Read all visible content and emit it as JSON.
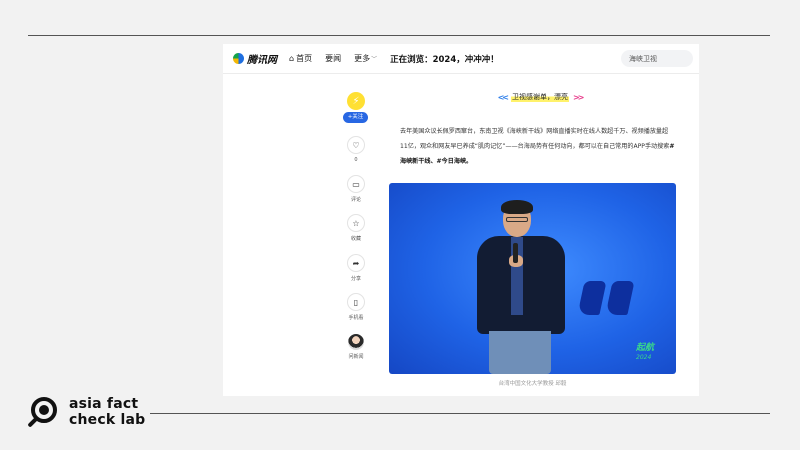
{
  "nav": {
    "logo_text": "腾讯网",
    "items": [
      "首页",
      "要闻",
      "更多"
    ],
    "headline": "正在浏览：2024，冲冲冲！",
    "search_value": "海峡卫视"
  },
  "sidebar": {
    "follow_label": "+关注",
    "actions": [
      {
        "label": "0",
        "icon": "heart-icon"
      },
      {
        "label": "评论",
        "icon": "comment-icon"
      },
      {
        "label": "收藏",
        "icon": "star-icon"
      },
      {
        "label": "分享",
        "icon": "share-icon"
      },
      {
        "label": "手机看",
        "icon": "phone-icon"
      },
      {
        "label": "问新闻",
        "icon": "avatar"
      }
    ]
  },
  "article": {
    "deco_title": "卫视感谢单，漂亮",
    "paragraph_plain": "去年美国众议长佩罗西窜台，东南卫视《海峡新干线》网络直播实时在线人数超千万、视频播放量超11亿，观众和网友早已养成“肌肉记忆”——台海局势有任何动向，都可以在自己常用的APP手动搜索",
    "paragraph_bold": "#海峡新干线、#今日海峡。",
    "photo_logo_1": "起航",
    "photo_logo_2": "2024",
    "caption": "台湾中国文化大学教授 邱毅"
  },
  "brand": {
    "line1": "asia fact",
    "line2": "check lab"
  }
}
